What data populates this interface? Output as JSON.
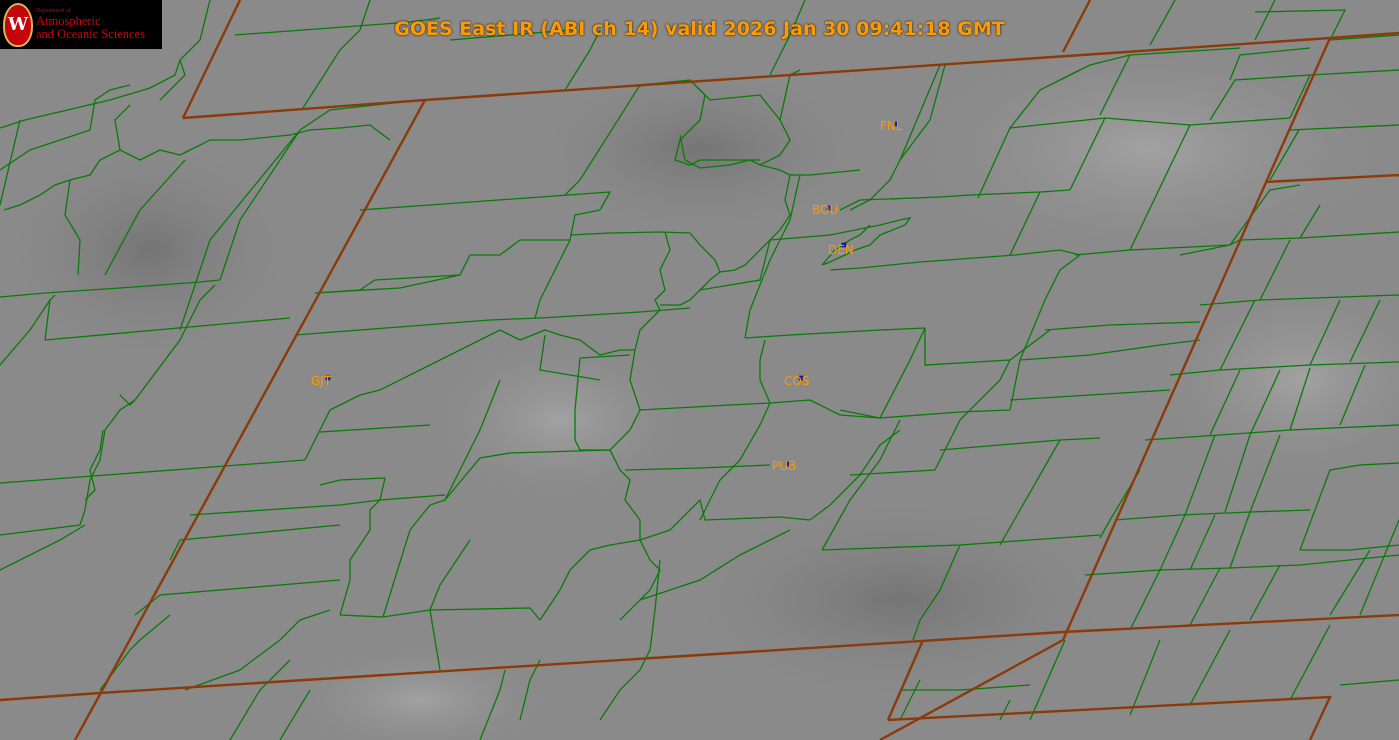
{
  "title": "GOES East IR (ABI ch 14) valid 2026 Jan 30 09:41:18 GMT",
  "logo": {
    "dept": "Department of",
    "line1": "Atmospheric",
    "line2": "and Oceanic Sciences",
    "seal_letter": "W"
  },
  "stations": [
    {
      "id": "FNL"
    },
    {
      "id": "BOU"
    },
    {
      "id": "DEN"
    },
    {
      "id": "GJT"
    },
    {
      "id": "COS"
    },
    {
      "id": "PUB"
    }
  ],
  "colors": {
    "background_ir_gray": "#8a8a8a",
    "county_lines": "#0a7a0a",
    "state_lines": "#8b3a0a",
    "label_orange": "#ff9900",
    "station_marker": "#1a1aff"
  }
}
